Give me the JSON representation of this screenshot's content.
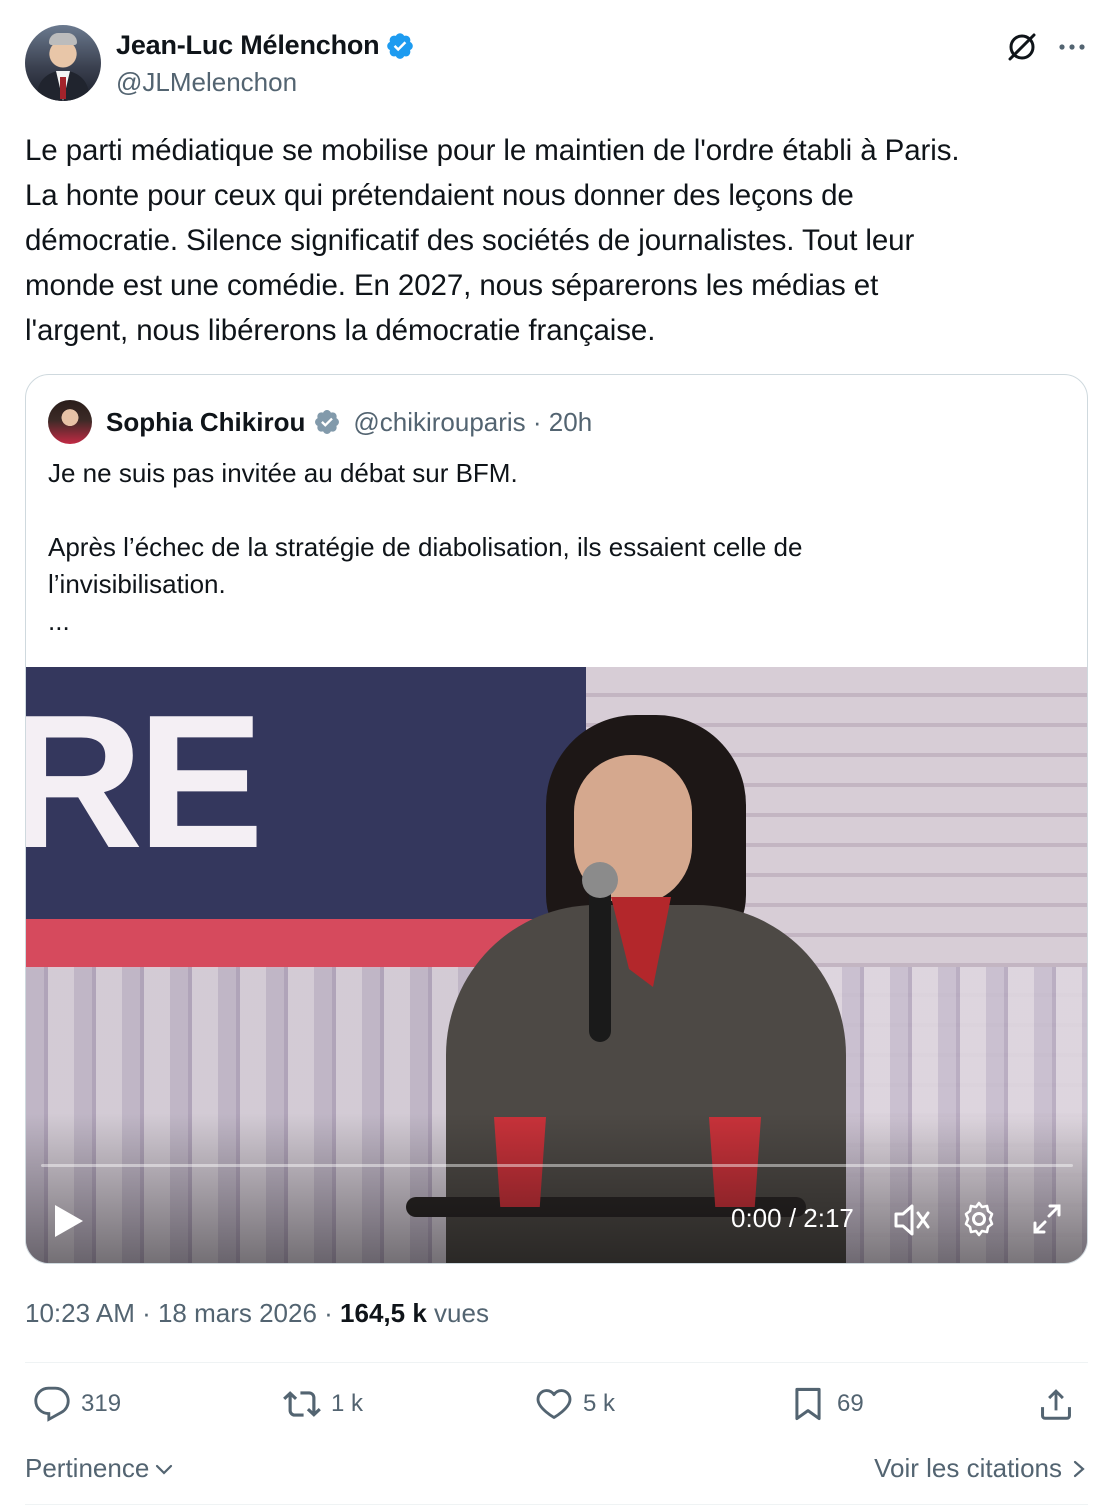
{
  "author": {
    "name": "Jean-Luc Mélenchon",
    "handle": "@JLMelenchon",
    "verified_color": "#1d9bf0"
  },
  "tweet": {
    "lines": [
      "Le parti médiatique se mobilise pour le maintien de l'ordre établi à Paris.",
      "La honte pour ceux qui prétendaient nous donner des leçons de",
      "démocratie. Silence significatif des sociétés de journalistes. Tout leur",
      "monde est une comédie. En 2027, nous séparerons les médias et",
      "l'argent, nous libérerons la démocratie française."
    ]
  },
  "quote": {
    "name": "Sophia Chikirou",
    "handle_time": "@chikirouparis · 20h",
    "verified_color": "#829aab",
    "lines": [
      "Je ne suis pas invitée au débat sur BFM.",
      "",
      "Après l’échec de la stratégie de diabolisation, ils essaient celle de",
      "l’invisibilisation.",
      "..."
    ]
  },
  "video": {
    "banner_text": "RE",
    "time": "0:00 / 2:17",
    "progress": 0
  },
  "meta": {
    "timestamp": "10:23 AM · 18 mars 2026 · ",
    "views_count": "164,5 k",
    "views_label": " vues"
  },
  "actions": {
    "replies": "319",
    "reposts": "1 k",
    "likes": "5 k",
    "bookmarks": "69"
  },
  "footer": {
    "sort_label": "Pertinence",
    "quotes_label": "Voir les citations"
  },
  "colors": {
    "text": "#0f1419",
    "secondary": "#536471",
    "border": "#cfd9de"
  }
}
